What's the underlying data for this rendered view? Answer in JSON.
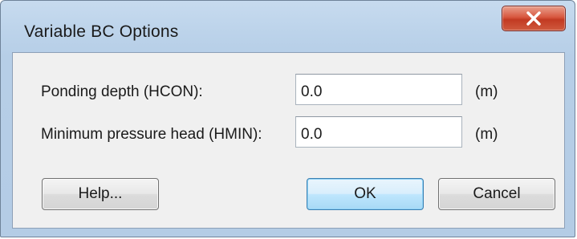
{
  "window": {
    "title": "Variable BC Options",
    "close_icon": "close-x-icon"
  },
  "fields": [
    {
      "label": "Ponding depth (HCON):",
      "value": "0.0",
      "unit": "(m)"
    },
    {
      "label": "Minimum pressure head (HMIN):",
      "value": "0.0",
      "unit": "(m)"
    }
  ],
  "buttons": {
    "help": "Help...",
    "ok": "OK",
    "cancel": "Cancel"
  },
  "colors": {
    "close_button": "#c8432a",
    "title_bar": "#bcd3ea",
    "default_button": "#bee6fd"
  }
}
